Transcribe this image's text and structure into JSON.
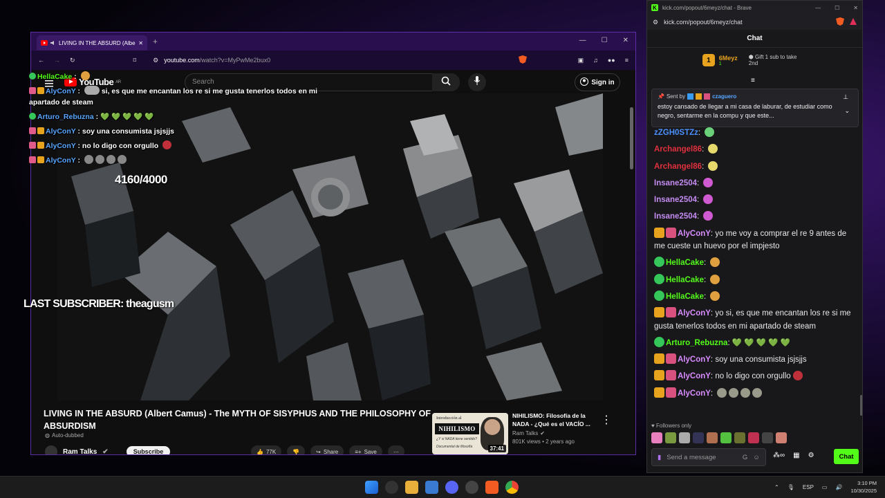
{
  "youtube_window": {
    "tab_title": "LIVING IN THE ABSURD (Albe",
    "url_host": "youtube.com",
    "url_path": "/watch?v=MyPwMe2bux0",
    "search_placeholder": "Search",
    "logo_text": "YouTube",
    "logo_region": "AR",
    "sign_in": "Sign in",
    "video_title": "LIVING IN THE ABSURD (Albert Camus) - The MYTH OF SISYPHUS AND THE PHILOSOPHY OF ABSURDISM",
    "auto_dubbed": "Auto-dubbed",
    "channel": "Ram Talks",
    "subscribe": "Subscribe",
    "likes": "77K",
    "share": "Share",
    "save": "Save",
    "recommended": {
      "title": "NIHILISMO: Filosofía de la NADA - ¿Qué es el VACÍO ...",
      "channel": "Ram Talks",
      "views": "801K views • 2 years ago",
      "duration": "37:41",
      "thumb_intro": "Introducción al",
      "thumb_word": "NIHILISMO",
      "thumb_q": "¿Y si NADA tiene sentido?",
      "thumb_q2": "Documental de filosofía"
    }
  },
  "overlay": {
    "lines": [
      {
        "user": "HellaCake",
        "text": "",
        "badges": [
          "check"
        ],
        "color": "green"
      },
      {
        "user": "AlyConY",
        "text": "si, es que me encantan los re si me gusta tenerlos todos en mi apartado de steam",
        "badges": [
          "pink",
          "crown"
        ],
        "color": "blue"
      },
      {
        "user": "Arturo_Rebuzna",
        "text": "💚 💚 💚 💚 💚",
        "badges": [
          "check"
        ],
        "color": "blue"
      },
      {
        "user": "AlyConY",
        "text": "soy una consumista jsjsjjs",
        "badges": [
          "pink",
          "crown"
        ],
        "color": "blue"
      },
      {
        "user": "AlyConY",
        "text": "no lo digo con orgullo",
        "badges": [
          "pink",
          "crown"
        ],
        "color": "blue"
      },
      {
        "user": "AlyConY",
        "text": "",
        "badges": [
          "pink",
          "crown"
        ],
        "color": "blue"
      }
    ],
    "sub_goal": "4160/4000",
    "last_subscriber": "LAST SUBSCRIBER: theagusm"
  },
  "kick": {
    "window_title": "kick.com/popout/6meyz/chat - Brave",
    "url": "kick.com/popout/6meyz/chat",
    "header": "Chat",
    "gift_user": "6Meyz",
    "gift_count": "1",
    "gift_text": "Gift 1 sub to take 2nd",
    "pinned_sent_by": "Sent by",
    "pinned_user": "czaguero",
    "pinned_msg": "estoy cansado de llegar a mi casa de laburar, de estudiar como negro, sentarme en la compu y que este...",
    "messages": [
      {
        "user": "zZGH0STZz",
        "text": "",
        "color": "blue",
        "badges": [],
        "emotes": [
          "#6ad17a"
        ]
      },
      {
        "user": "Archangel86",
        "text": "",
        "color": "red",
        "badges": [],
        "emotes": [
          "#e6d86b"
        ]
      },
      {
        "user": "Archangel86",
        "text": "",
        "color": "red",
        "badges": [],
        "emotes": [
          "#e6d86b"
        ]
      },
      {
        "user": "Insane2504",
        "text": "",
        "color": "purple",
        "badges": [],
        "emotes": [
          "#d05ad0"
        ]
      },
      {
        "user": "Insane2504",
        "text": "",
        "color": "purple",
        "badges": [],
        "emotes": [
          "#d05ad0"
        ]
      },
      {
        "user": "Insane2504",
        "text": "",
        "color": "purple",
        "badges": [],
        "emotes": [
          "#d05ad0"
        ]
      },
      {
        "user": "AlyConY",
        "text": "yo me voy a comprar el re 9 antes de me cueste un huevo por el impjesto",
        "color": "pink",
        "badges": [
          "crown",
          "pink"
        ],
        "emotes": []
      },
      {
        "user": "HellaCake",
        "text": "",
        "color": "green",
        "badges": [
          "check"
        ],
        "emotes": [
          "#e0a040"
        ]
      },
      {
        "user": "HellaCake",
        "text": "",
        "color": "green",
        "badges": [
          "check"
        ],
        "emotes": [
          "#e0a040"
        ]
      },
      {
        "user": "HellaCake",
        "text": "",
        "color": "green",
        "badges": [
          "check"
        ],
        "emotes": [
          "#e0a040"
        ]
      },
      {
        "user": "AlyConY",
        "text": "yo si, es que me encantan los re si me gusta tenerlos todos en mi apartado de steam",
        "color": "pink",
        "badges": [
          "crown",
          "pink"
        ],
        "emotes": []
      },
      {
        "user": "Arturo_Rebuzna",
        "text": "💚 💚 💚 💚 💚",
        "color": "green",
        "badges": [
          "check"
        ],
        "emotes": []
      },
      {
        "user": "AlyConY",
        "text": "soy una consumista jsjsjjs",
        "color": "pink",
        "badges": [
          "crown",
          "pink"
        ],
        "emotes": []
      },
      {
        "user": "AlyConY",
        "text": "no lo digo con orgullo",
        "color": "pink",
        "badges": [
          "crown",
          "pink"
        ],
        "emotes": [
          "#c0303a"
        ]
      },
      {
        "user": "AlyConY",
        "text": "",
        "color": "pink",
        "badges": [
          "crown",
          "pink"
        ],
        "emotes": [
          "#9a9a8a",
          "#9a9a8a",
          "#9a9a8a",
          "#9a9a8a"
        ]
      }
    ],
    "followers_only": "Followers only",
    "input_placeholder": "Send a message",
    "chat_button": "Chat"
  },
  "taskbar": {
    "lang": "ESP",
    "time": "3:10 PM",
    "date": "10/30/2025"
  }
}
